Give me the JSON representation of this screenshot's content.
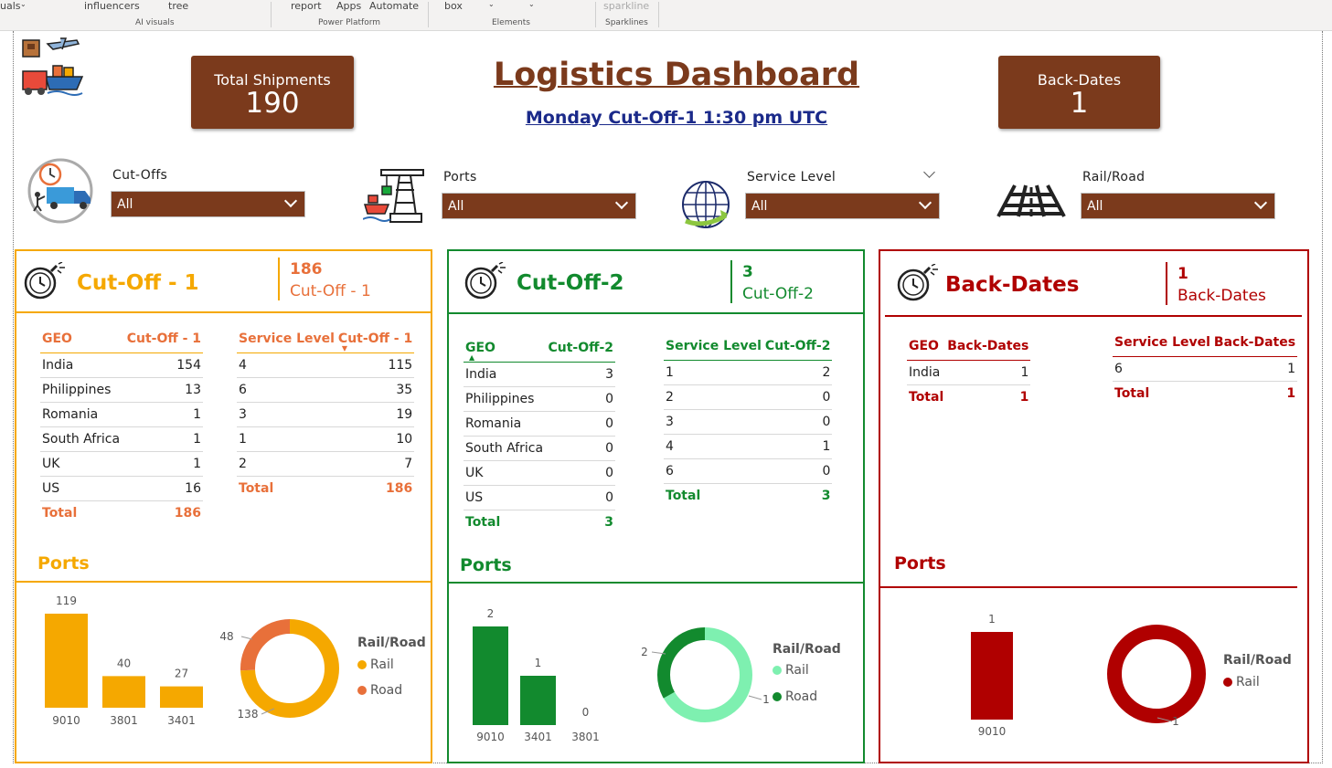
{
  "ribbon": {
    "items": [
      "uals",
      "influencers",
      "tree",
      "report",
      "Apps",
      "Automate",
      "box",
      "sparkline"
    ],
    "groups": [
      "AI visuals",
      "Power Platform",
      "Elements",
      "Sparklines"
    ]
  },
  "header": {
    "title": "Logistics Dashboard",
    "subtitle": "Monday Cut-Off-1 1:30 pm UTC",
    "total_shipments_label": "Total Shipments",
    "total_shipments_value": "190",
    "back_dates_label": "Back-Dates",
    "back_dates_value": "1"
  },
  "slicers": [
    {
      "label": "Cut-Offs",
      "value": "All"
    },
    {
      "label": "Ports",
      "value": "All"
    },
    {
      "label": "Service Level",
      "value": "All"
    },
    {
      "label": "Rail/Road",
      "value": "All"
    }
  ],
  "panels": {
    "cutoff1": {
      "title": "Cut-Off - 1",
      "count": "186",
      "count_label": "Cut-Off - 1",
      "geo_table": {
        "headers": [
          "GEO",
          "Cut-Off - 1"
        ],
        "rows": [
          [
            "India",
            "154"
          ],
          [
            "Philippines",
            "13"
          ],
          [
            "Romania",
            "1"
          ],
          [
            "South Africa",
            "1"
          ],
          [
            "UK",
            "1"
          ],
          [
            "US",
            "16"
          ]
        ],
        "total": [
          "Total",
          "186"
        ]
      },
      "sl_table": {
        "headers": [
          "Service Level",
          "Cut-Off - 1"
        ],
        "rows": [
          [
            "4",
            "115"
          ],
          [
            "6",
            "35"
          ],
          [
            "3",
            "19"
          ],
          [
            "1",
            "10"
          ],
          [
            "2",
            "7"
          ]
        ],
        "total": [
          "Total",
          "186"
        ]
      },
      "ports_label": "Ports",
      "legend_title": "Rail/Road",
      "legend": [
        "Rail",
        "Road"
      ]
    },
    "cutoff2": {
      "title": "Cut-Off-2",
      "count": "3",
      "count_label": "Cut-Off-2",
      "geo_table": {
        "headers": [
          "GEO",
          "Cut-Off-2"
        ],
        "rows": [
          [
            "India",
            "3"
          ],
          [
            "Philippines",
            "0"
          ],
          [
            "Romania",
            "0"
          ],
          [
            "South Africa",
            "0"
          ],
          [
            "UK",
            "0"
          ],
          [
            "US",
            "0"
          ]
        ],
        "total": [
          "Total",
          "3"
        ]
      },
      "sl_table": {
        "headers": [
          "Service Level",
          "Cut-Off-2"
        ],
        "rows": [
          [
            "1",
            "2"
          ],
          [
            "2",
            "0"
          ],
          [
            "3",
            "0"
          ],
          [
            "4",
            "1"
          ],
          [
            "6",
            "0"
          ]
        ],
        "total": [
          "Total",
          "3"
        ]
      },
      "ports_label": "Ports",
      "legend_title": "Rail/Road",
      "legend": [
        "Rail",
        "Road"
      ]
    },
    "backdates": {
      "title": "Back-Dates",
      "count": "1",
      "count_label": "Back-Dates",
      "geo_table": {
        "headers": [
          "GEO",
          "Back-Dates"
        ],
        "rows": [
          [
            "India",
            "1"
          ]
        ],
        "total": [
          "Total",
          "1"
        ]
      },
      "sl_table": {
        "headers": [
          "Service Level",
          "Back-Dates"
        ],
        "rows": [
          [
            "6",
            "1"
          ]
        ],
        "total": [
          "Total",
          "1"
        ]
      },
      "ports_label": "Ports",
      "legend_title": "Rail/Road",
      "legend": [
        "Rail"
      ]
    }
  },
  "chart_data": [
    {
      "type": "bar",
      "panel": "cutoff1",
      "categories": [
        "9010",
        "3801",
        "3401"
      ],
      "values": [
        119,
        40,
        27
      ],
      "color": "#f5a800"
    },
    {
      "type": "pie",
      "panel": "cutoff1",
      "donut": true,
      "labels": [
        "Rail",
        "Road"
      ],
      "values": [
        138,
        48
      ],
      "colors": [
        "#f5a800",
        "#e8703a"
      ]
    },
    {
      "type": "bar",
      "panel": "cutoff2",
      "categories": [
        "9010",
        "3401",
        "3801"
      ],
      "values": [
        2,
        1,
        0
      ],
      "color": "#128a2e"
    },
    {
      "type": "pie",
      "panel": "cutoff2",
      "donut": true,
      "labels": [
        "Rail",
        "Road"
      ],
      "values": [
        2,
        1
      ],
      "colors": [
        "#7ef0b0",
        "#128a2e"
      ]
    },
    {
      "type": "bar",
      "panel": "backdates",
      "categories": [
        "9010"
      ],
      "values": [
        1
      ],
      "color": "#b00000"
    },
    {
      "type": "pie",
      "panel": "backdates",
      "donut": true,
      "labels": [
        "Rail"
      ],
      "values": [
        1
      ],
      "colors": [
        "#b00000"
      ]
    }
  ]
}
